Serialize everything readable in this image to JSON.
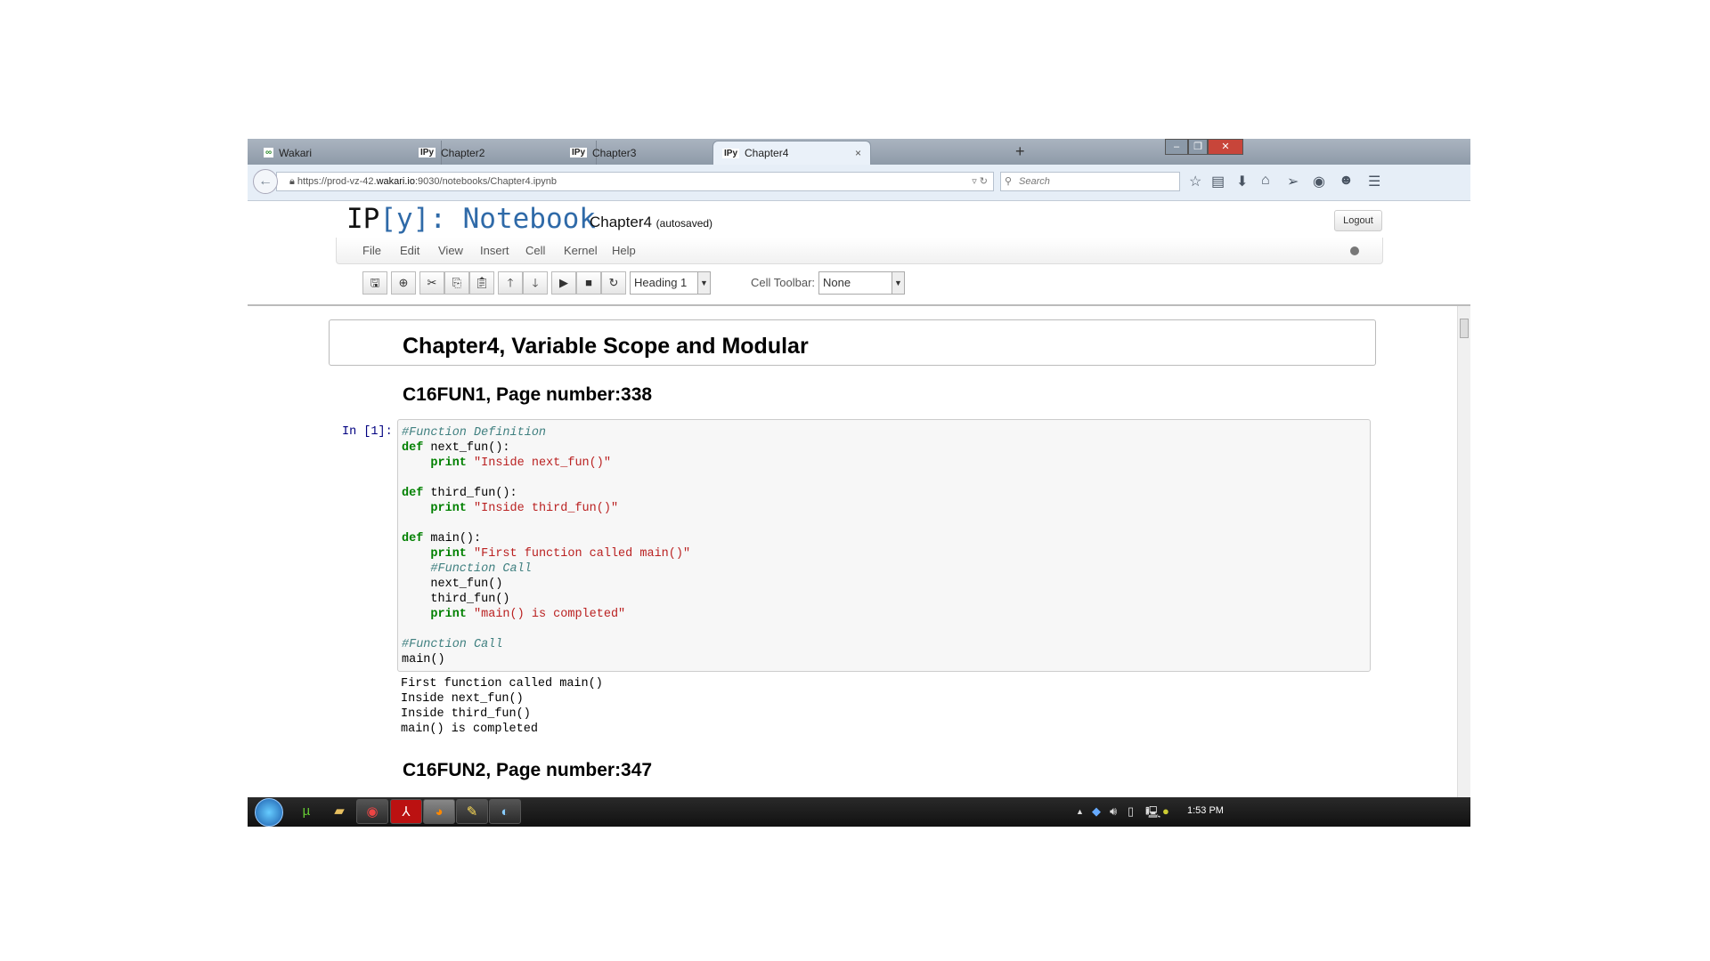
{
  "browser": {
    "tabs": [
      {
        "icon": "wakari-icon",
        "label": "Wakari"
      },
      {
        "icon": "IPy",
        "label": "Chapter2"
      },
      {
        "icon": "IPy",
        "label": "Chapter3"
      },
      {
        "icon": "IPy",
        "label": "Chapter4",
        "active": true
      }
    ],
    "url_prefix": "https://prod-vz-42.",
    "url_domain": "wakari.io",
    "url_suffix": ":9030/notebooks/Chapter4.ipynb",
    "search_placeholder": "Search",
    "close_glyph": "×",
    "new_tab_glyph": "+"
  },
  "notebook": {
    "logo_ip": "IP",
    "logo_rest": "[y]: Notebook",
    "name": "Chapter4",
    "status": "(autosaved)",
    "logout": "Logout",
    "menu": [
      "File",
      "Edit",
      "View",
      "Insert",
      "Cell",
      "Kernel",
      "Help"
    ],
    "cell_type": "Heading 1",
    "cell_toolbar_label": "Cell Toolbar:",
    "cell_toolbar_value": "None"
  },
  "cells": {
    "title": "Chapter4, Variable Scope and Modular",
    "heading1": "C16FUN1, Page number:338",
    "prompt": "In [1]:",
    "heading2": "C16FUN2, Page number:347",
    "output": [
      "First function called main()",
      "Inside next_fun()",
      "Inside third_fun()",
      "main() is completed"
    ]
  },
  "taskbar": {
    "time": "1:53 PM"
  },
  "colors": {
    "accent": "#2f6aa8",
    "keyword": "#008000",
    "string": "#ba2121",
    "comment": "#408080",
    "prompt": "#000080"
  }
}
